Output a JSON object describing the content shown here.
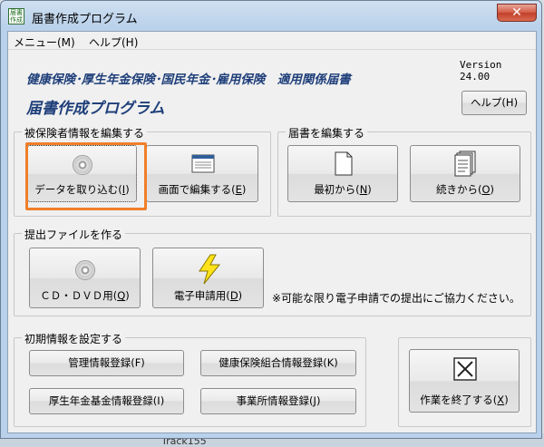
{
  "window": {
    "title": "届書作成プログラム",
    "close_glyph": "✕",
    "icon_text": "届書作成"
  },
  "menu": {
    "items": [
      {
        "label": "メニュー(M)"
      },
      {
        "label": "ヘルプ(H)"
      }
    ]
  },
  "header": {
    "version": "Version 24.00",
    "headline": "健康保険･厚生年金保険･国民年金･雇用保険　適用関係届書",
    "app_title": "届書作成プログラム",
    "help_button": "ヘルプ(H)"
  },
  "edit_insured": {
    "legend": "被保険者情報を編集する",
    "import_button": {
      "text": "データを取り込む(",
      "key": "I",
      "end": ")",
      "icon": "cd-icon"
    },
    "screen_button": {
      "text": "画面で編集する(",
      "key": "E",
      "end": ")",
      "icon": "window-icon"
    }
  },
  "edit_forms": {
    "legend": "届書を編集する",
    "new_button": {
      "text": "最初から(",
      "key": "N",
      "end": ")",
      "icon": "document-icon"
    },
    "continue_button": {
      "text": "続きから(",
      "key": "O",
      "end": ")",
      "icon": "document-stack-icon"
    }
  },
  "submit_file": {
    "legend": "提出ファイルを作る",
    "cd_button": {
      "text": "ＣＤ・ＤＶＤ用(",
      "key": "Q",
      "end": ")",
      "icon": "cd-icon"
    },
    "e_apply_button": {
      "text": "電子申請用(",
      "key": "D",
      "end": ")",
      "icon": "lightning-icon"
    },
    "note": "※可能な限り電子申請での提出にご協力ください。"
  },
  "initial_settings": {
    "legend": "初期情報を設定する",
    "buttons": [
      {
        "text": "管理情報登録(F)"
      },
      {
        "text": "健康保険組合情報登録(K)"
      },
      {
        "text": "厚生年金基金情報登録(I)"
      },
      {
        "text": "事業所情報登録(J)"
      }
    ]
  },
  "exit_button": {
    "text": "作業を終了する(",
    "key": "X",
    "end": ")",
    "icon": "close-box-icon"
  },
  "background": {
    "taskbar_text": "Track155"
  },
  "colors": {
    "title_blue": "#1f3f7a",
    "highlight": "#f07f2a",
    "close_red": "#c23f2a"
  }
}
